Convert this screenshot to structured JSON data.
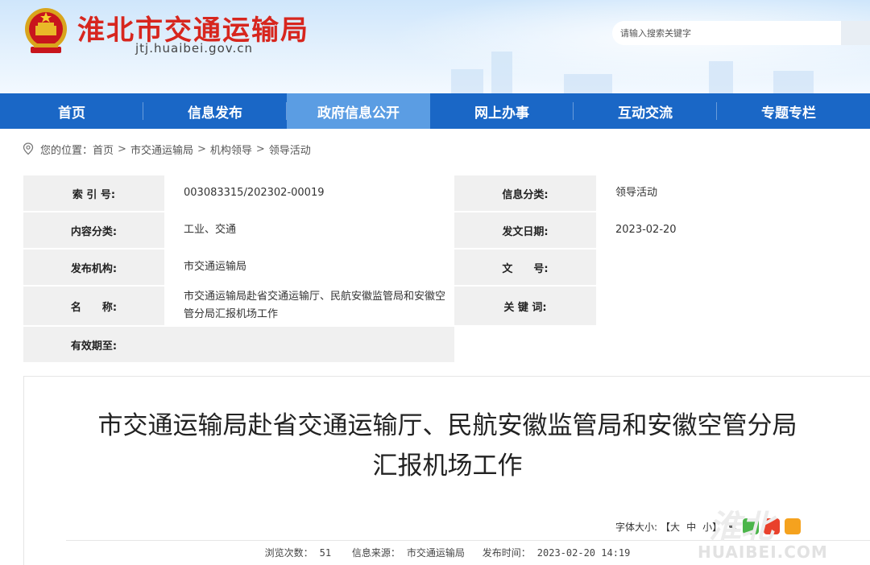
{
  "header": {
    "site_title": "淮北市交通运输局",
    "domain": "jtj.huaibei.gov.cn",
    "search_placeholder": "请输入搜索关键字"
  },
  "nav": {
    "items": [
      {
        "label": "首页"
      },
      {
        "label": "信息发布"
      },
      {
        "label": "政府信息公开",
        "active": true
      },
      {
        "label": "网上办事"
      },
      {
        "label": "互动交流"
      },
      {
        "label": "专题专栏"
      }
    ]
  },
  "breadcrumb": {
    "prefix": "您的位置：",
    "items": [
      "首页",
      "市交通运输局",
      "机构领导",
      "领导活动"
    ],
    "separator": ">"
  },
  "meta": {
    "index_label": "索 引 号:",
    "index_value": "003083315/202302-00019",
    "info_cat_label": "信息分类:",
    "info_cat_value": "领导活动",
    "content_cat_label": "内容分类:",
    "content_cat_value": "工业、交通",
    "pub_date_label": "发文日期:",
    "pub_date_value": "2023-02-20",
    "org_label": "发布机构:",
    "org_value": "市交通运输局",
    "doc_no_label": "文　　号:",
    "doc_no_value": "",
    "name_label": "名　　称:",
    "name_value": "市交通运输局赴省交通运输厅、民航安徽监管局和安徽空管分局汇报机场工作",
    "keywords_label": "关 键 词:",
    "keywords_value": "",
    "valid_label": "有效期至:",
    "valid_value": ""
  },
  "article": {
    "title_line1": "市交通运输局赴省交通运输厅、民航安徽监管局和安徽空管分局",
    "title_line2": "汇报机场工作",
    "font_size_label": "字体大小:",
    "font_large": "【大",
    "font_medium": "中",
    "font_small": "小】",
    "views_label": "浏览次数：",
    "views_value": "51",
    "source_label": "信息来源：",
    "source_value": "市交通运输局",
    "pub_time_label": "发布时间：",
    "pub_time_value": "2023-02-20 14:19"
  },
  "watermark": {
    "text": "HUAIBEI.COM",
    "cn": "淮北"
  },
  "colors": {
    "nav_bg": "#1a67c6",
    "nav_active": "#5b9de3",
    "title_red": "#d7261e",
    "label_bg": "#f0f0f0"
  },
  "icons": [
    "national-emblem-icon",
    "location-pin-icon",
    "share-icon",
    "wechat-icon",
    "weibo-icon",
    "qzone-icon",
    "search-icon"
  ]
}
